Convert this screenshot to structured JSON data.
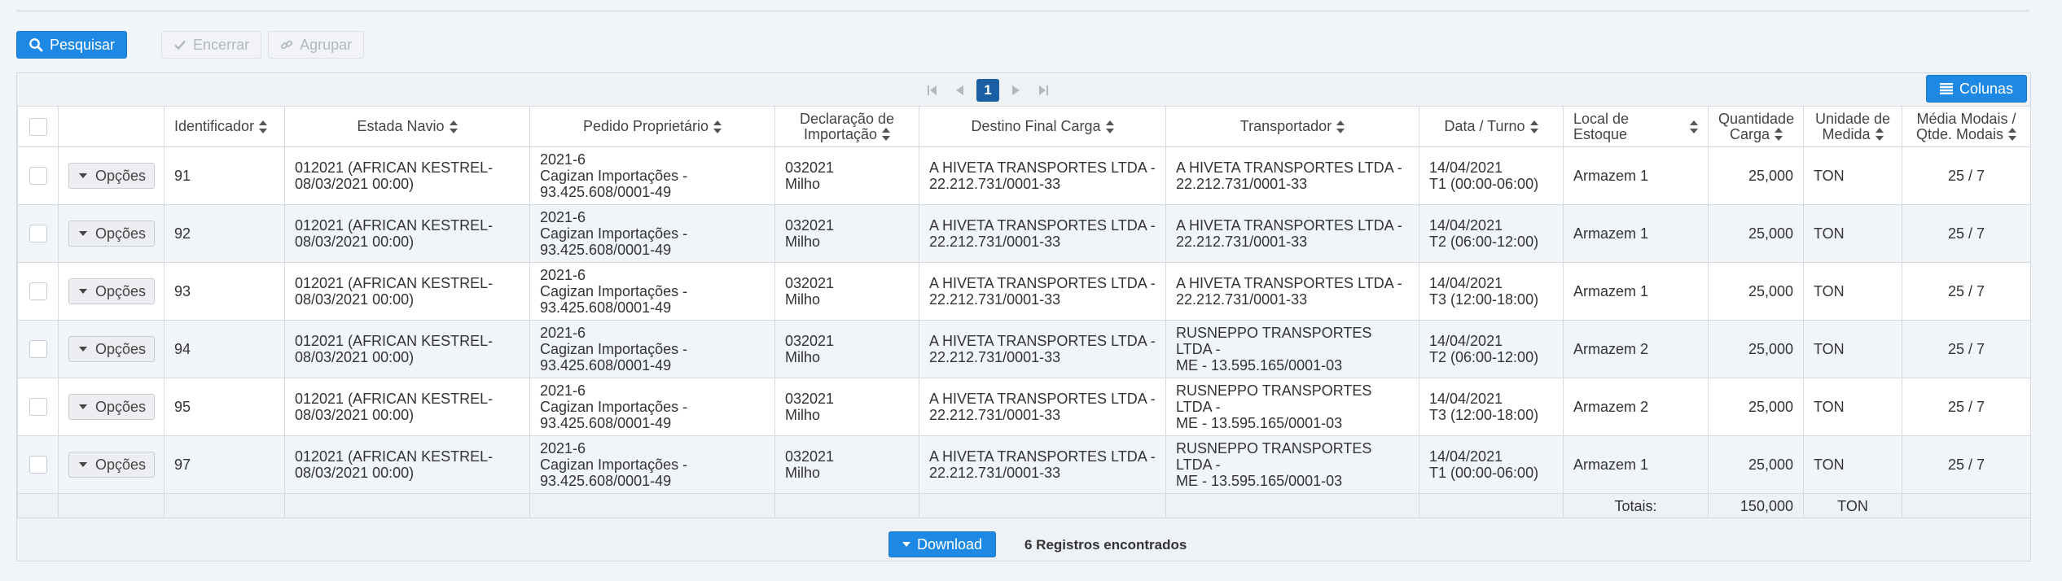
{
  "toolbar": {
    "search_label": "Pesquisar",
    "close_label": "Encerrar",
    "group_label": "Agrupar"
  },
  "pager": {
    "current_page": "1"
  },
  "columns_button_label": "Colunas",
  "table": {
    "headers": {
      "identificador": "Identificador",
      "estada_navio": "Estada Navio",
      "pedido_proprietario": "Pedido Proprietário",
      "declaracao_l1": "Declaração de",
      "declaracao_l2": "Importação",
      "destino": "Destino Final Carga",
      "transportador": "Transportador",
      "data_turno": "Data / Turno",
      "local_estoque": "Local de Estoque",
      "quantidade_l1": "Quantidade",
      "quantidade_l2": "Carga",
      "unidade_l1": "Unidade de",
      "unidade_l2": "Medida",
      "media_l1": "Média Modais /",
      "media_l2": "Qtde. Modais"
    },
    "options_label": "Opções",
    "rows": [
      {
        "id": "91",
        "estada_l1": "012021 (AFRICAN KESTREL-",
        "estada_l2": "08/03/2021 00:00)",
        "pedido_l1": "2021-6",
        "pedido_l2": "Cagizan Importações -",
        "pedido_l3": "93.425.608/0001-49",
        "decl_l1": "032021",
        "decl_l2": "Milho",
        "destino_l1": "A HIVETA TRANSPORTES LTDA -",
        "destino_l2": "22.212.731/0001-33",
        "transp_l1": "A HIVETA TRANSPORTES LTDA -",
        "transp_l2": "22.212.731/0001-33",
        "data_l1": "14/04/2021",
        "data_l2": "T1 (00:00-06:00)",
        "local": "Armazem 1",
        "qtd": "25,000",
        "unidade": "TON",
        "media": "25 / 7"
      },
      {
        "id": "92",
        "estada_l1": "012021 (AFRICAN KESTREL-",
        "estada_l2": "08/03/2021 00:00)",
        "pedido_l1": "2021-6",
        "pedido_l2": "Cagizan Importações -",
        "pedido_l3": "93.425.608/0001-49",
        "decl_l1": "032021",
        "decl_l2": "Milho",
        "destino_l1": "A HIVETA TRANSPORTES LTDA -",
        "destino_l2": "22.212.731/0001-33",
        "transp_l1": "A HIVETA TRANSPORTES LTDA -",
        "transp_l2": "22.212.731/0001-33",
        "data_l1": "14/04/2021",
        "data_l2": "T2 (06:00-12:00)",
        "local": "Armazem 1",
        "qtd": "25,000",
        "unidade": "TON",
        "media": "25 / 7"
      },
      {
        "id": "93",
        "estada_l1": "012021 (AFRICAN KESTREL-",
        "estada_l2": "08/03/2021 00:00)",
        "pedido_l1": "2021-6",
        "pedido_l2": "Cagizan Importações -",
        "pedido_l3": "93.425.608/0001-49",
        "decl_l1": "032021",
        "decl_l2": "Milho",
        "destino_l1": "A HIVETA TRANSPORTES LTDA -",
        "destino_l2": "22.212.731/0001-33",
        "transp_l1": "A HIVETA TRANSPORTES LTDA -",
        "transp_l2": "22.212.731/0001-33",
        "data_l1": "14/04/2021",
        "data_l2": "T3 (12:00-18:00)",
        "local": "Armazem 1",
        "qtd": "25,000",
        "unidade": "TON",
        "media": "25 / 7"
      },
      {
        "id": "94",
        "estada_l1": "012021 (AFRICAN KESTREL-",
        "estada_l2": "08/03/2021 00:00)",
        "pedido_l1": "2021-6",
        "pedido_l2": "Cagizan Importações -",
        "pedido_l3": "93.425.608/0001-49",
        "decl_l1": "032021",
        "decl_l2": "Milho",
        "destino_l1": "A HIVETA TRANSPORTES LTDA -",
        "destino_l2": "22.212.731/0001-33",
        "transp_l1": "RUSNEPPO TRANSPORTES LTDA -",
        "transp_l2": "ME - 13.595.165/0001-03",
        "data_l1": "14/04/2021",
        "data_l2": "T2 (06:00-12:00)",
        "local": "Armazem 2",
        "qtd": "25,000",
        "unidade": "TON",
        "media": "25 / 7"
      },
      {
        "id": "95",
        "estada_l1": "012021 (AFRICAN KESTREL-",
        "estada_l2": "08/03/2021 00:00)",
        "pedido_l1": "2021-6",
        "pedido_l2": "Cagizan Importações -",
        "pedido_l3": "93.425.608/0001-49",
        "decl_l1": "032021",
        "decl_l2": "Milho",
        "destino_l1": "A HIVETA TRANSPORTES LTDA -",
        "destino_l2": "22.212.731/0001-33",
        "transp_l1": "RUSNEPPO TRANSPORTES LTDA -",
        "transp_l2": "ME - 13.595.165/0001-03",
        "data_l1": "14/04/2021",
        "data_l2": "T3 (12:00-18:00)",
        "local": "Armazem 2",
        "qtd": "25,000",
        "unidade": "TON",
        "media": "25 / 7"
      },
      {
        "id": "97",
        "estada_l1": "012021 (AFRICAN KESTREL-",
        "estada_l2": "08/03/2021 00:00)",
        "pedido_l1": "2021-6",
        "pedido_l2": "Cagizan Importações -",
        "pedido_l3": "93.425.608/0001-49",
        "decl_l1": "032021",
        "decl_l2": "Milho",
        "destino_l1": "A HIVETA TRANSPORTES LTDA -",
        "destino_l2": "22.212.731/0001-33",
        "transp_l1": "RUSNEPPO TRANSPORTES LTDA -",
        "transp_l2": "ME - 13.595.165/0001-03",
        "data_l1": "14/04/2021",
        "data_l2": "T1 (00:00-06:00)",
        "local": "Armazem 1",
        "qtd": "25,000",
        "unidade": "TON",
        "media": "25 / 7"
      }
    ],
    "totals": {
      "label": "Totais:",
      "quantidade": "150,000",
      "unidade": "TON"
    }
  },
  "footer": {
    "download_label": "Download",
    "records_text": "6 Registros encontrados"
  },
  "icons": {
    "search": "search-icon",
    "check": "check-icon",
    "link": "link-icon",
    "first": "first-page-icon",
    "prev": "prev-page-icon",
    "next": "next-page-icon",
    "last": "last-page-icon",
    "columns": "list-icon",
    "caret": "caret-down-icon"
  },
  "colors": {
    "primary": "#1e88e5",
    "current_page": "#1a5fa3",
    "background": "#f1f4f8"
  }
}
